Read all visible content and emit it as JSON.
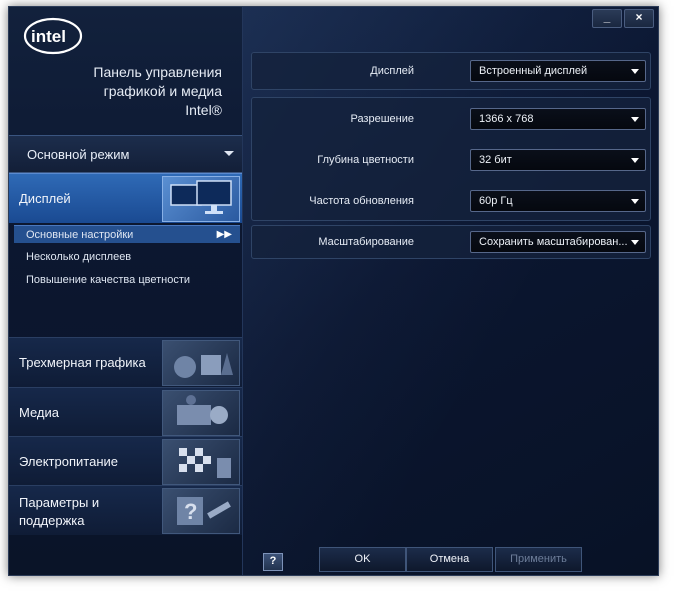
{
  "window": {
    "brand_lines": [
      "Панель управления",
      "графикой и медиа",
      "Intel®"
    ],
    "logo_text": "intel",
    "controls": {
      "minimize_label": "_",
      "close_label": "×"
    }
  },
  "sidebar": {
    "mode": {
      "label": "Основной режим"
    },
    "categories": [
      {
        "label": "Дисплей",
        "active": true
      },
      {
        "label": "Трехмерная графика",
        "active": false
      },
      {
        "label": "Медиа",
        "active": false
      },
      {
        "label": "Электропитание",
        "active": false
      },
      {
        "label_line1": "Параметры и",
        "label_line2": "поддержка",
        "active": false
      }
    ],
    "display_subitems": [
      {
        "label": "Основные настройки",
        "active": true,
        "arrows": "▶▶"
      },
      {
        "label": "Несколько дисплеев",
        "active": false
      },
      {
        "label": "Повышение качества цветности",
        "active": false
      }
    ]
  },
  "settings": {
    "display": {
      "label": "Дисплей",
      "value": "Встроенный дисплей"
    },
    "resolution": {
      "label": "Разрешение",
      "value": "1366 x 768"
    },
    "color_depth": {
      "label": "Глубина цветности",
      "value": "32 бит"
    },
    "refresh_rate": {
      "label": "Частота обновления",
      "value": "60p Гц"
    },
    "scaling": {
      "label": "Масштабирование",
      "value": "Сохранить масштабирован..."
    }
  },
  "footer": {
    "help_label": "?",
    "ok_label": "OK",
    "cancel_label": "Отмена",
    "apply_label": "Применить"
  }
}
